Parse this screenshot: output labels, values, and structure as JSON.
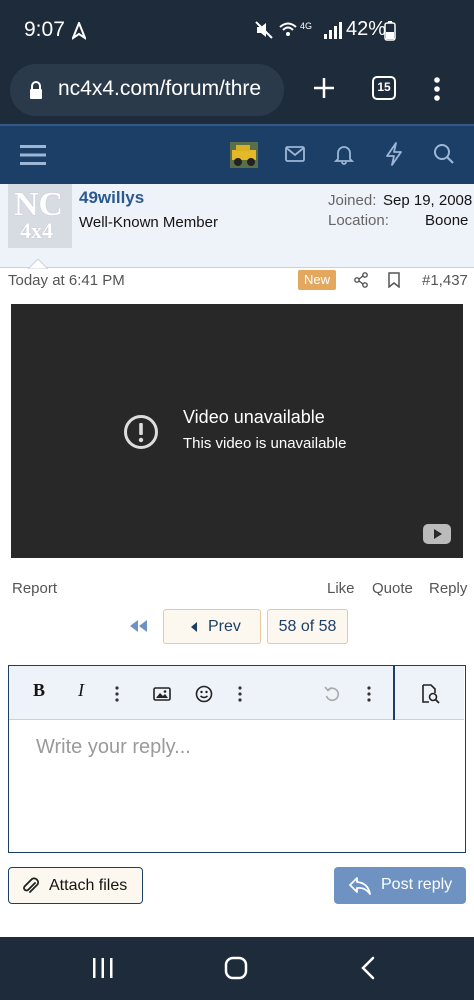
{
  "status_bar": {
    "time": "9:07",
    "battery": "42%"
  },
  "browser": {
    "url": "nc4x4.com/forum/thre",
    "tab_count": "15"
  },
  "site_nav": {
    "icons": [
      "menu-icon",
      "avatar-thumbnail",
      "mail-icon",
      "bell-icon",
      "lightning-icon",
      "search-icon"
    ]
  },
  "user": {
    "name": "49willys",
    "title": "Well-Known Member",
    "joined_label": "Joined:",
    "joined_value": "Sep 19, 2008",
    "location_label": "Location:",
    "location_value": "Boone",
    "avatar_text_top": "NC",
    "avatar_text_bottom": "4x4"
  },
  "post": {
    "time": "Today at 6:41 PM",
    "badge": "New",
    "number": "#1,437",
    "video_title": "Video unavailable",
    "video_subtitle": "This video is unavailable",
    "actions": {
      "report": "Report",
      "like": "Like",
      "quote": "Quote",
      "reply": "Reply"
    }
  },
  "pagination": {
    "prev": "Prev",
    "current": "58 of 58"
  },
  "editor": {
    "bold": "B",
    "italic": "I",
    "placeholder": "Write your reply..."
  },
  "buttons": {
    "attach": "Attach files",
    "post_reply": "Post reply"
  },
  "colors": {
    "nav_blue": "#1c3f67",
    "link_blue": "#2b5a8f",
    "badge_orange": "#e3a85d",
    "post_reply_blue": "#6e92c2"
  }
}
